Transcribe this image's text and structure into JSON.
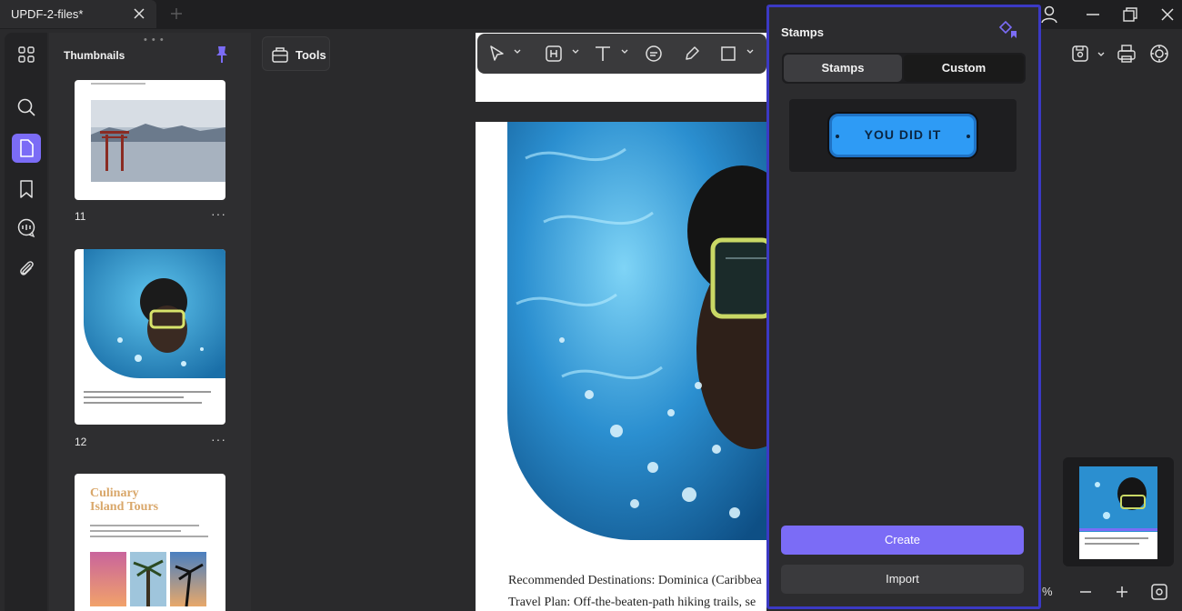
{
  "tab": {
    "title": "UPDF-2-files*"
  },
  "rail": {
    "items": [
      {
        "name": "apps-icon",
        "active": false
      },
      {
        "name": "search-icon",
        "active": false
      },
      {
        "name": "page-icon",
        "active": true
      },
      {
        "name": "bookmark-icon",
        "active": false
      },
      {
        "name": "comment-icon",
        "active": false
      },
      {
        "name": "attachment-icon",
        "active": false
      }
    ]
  },
  "thumbnails": {
    "title": "Thumbnails",
    "pages": [
      {
        "number": "11"
      },
      {
        "number": "12"
      },
      {
        "number": ""
      }
    ],
    "page13": {
      "title_line1": "Culinary",
      "title_line2": "Island Tours"
    }
  },
  "tools": {
    "label": "Tools"
  },
  "document": {
    "line1": "Recommended Destinations: Dominica (Caribbea",
    "line2": "Travel Plan: Off-the-beaten-path hiking trails, se"
  },
  "stamps_panel": {
    "title": "Stamps",
    "tabs": {
      "stamps": "Stamps",
      "custom": "Custom"
    },
    "stamp_text": "YOU DID IT",
    "create_label": "Create",
    "import_label": "Import"
  },
  "zoom": {
    "suffix": "%"
  },
  "colors": {
    "accent": "#7b6cf6",
    "panel_border": "#3b39c4",
    "stamp_blue": "#2e9bf5"
  }
}
